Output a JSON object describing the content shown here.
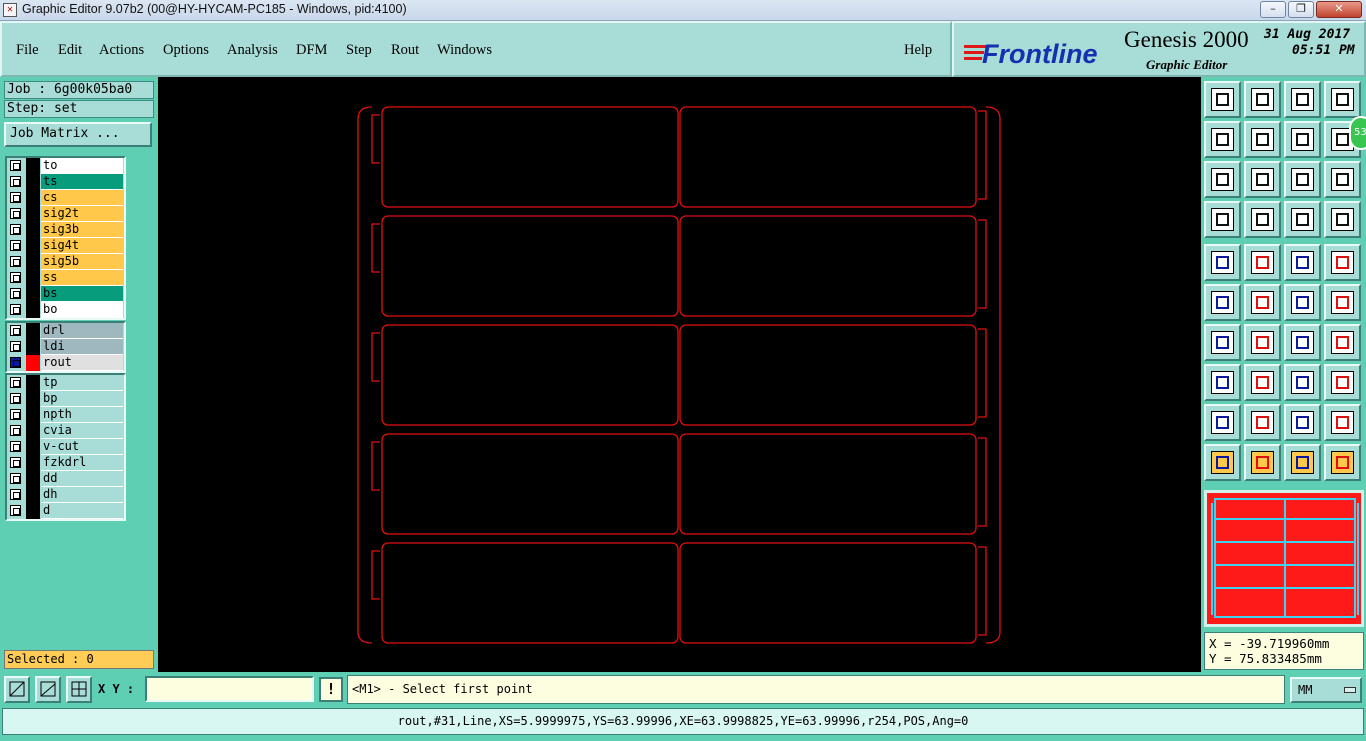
{
  "window": {
    "title": "Graphic Editor 9.07b2 (00@HY-HYCAM-PC185 - Windows, pid:4100)",
    "app_icon": "x-window-icon"
  },
  "menu": {
    "items": [
      "File",
      "Edit",
      "Actions",
      "Options",
      "Analysis",
      "DFM",
      "Step",
      "Rout",
      "Windows"
    ],
    "help": "Help"
  },
  "brand": {
    "logo": "Frontline",
    "product": "Genesis 2000",
    "subtitle": "Graphic Editor",
    "date": "31 Aug 2017",
    "time": "05:51 PM"
  },
  "job": {
    "job_label": "Job : 6g00k05ba0",
    "step_label": "Step: set",
    "matrix_button": "Job Matrix ..."
  },
  "layers": {
    "board": [
      {
        "name": "to",
        "color": "#ffffff"
      },
      {
        "name": "ts",
        "color": "#079c7c"
      },
      {
        "name": "cs",
        "color": "#ffc84a"
      },
      {
        "name": "sig2t",
        "color": "#ffc84a"
      },
      {
        "name": "sig3b",
        "color": "#ffc84a"
      },
      {
        "name": "sig4t",
        "color": "#ffc84a"
      },
      {
        "name": "sig5b",
        "color": "#ffc84a"
      },
      {
        "name": "ss",
        "color": "#ffc84a"
      },
      {
        "name": "bs",
        "color": "#079c7c"
      },
      {
        "name": "bo",
        "color": "#ffffff"
      }
    ],
    "drill": [
      {
        "name": "drl",
        "color": "#9fb8c0"
      },
      {
        "name": "ldi",
        "color": "#9fb8c0"
      },
      {
        "name": "rout",
        "color": "#e0e0e0",
        "active": true
      }
    ],
    "misc": [
      {
        "name": "tp",
        "color": "#a8dcd6"
      },
      {
        "name": "bp",
        "color": "#a8dcd6"
      },
      {
        "name": "npth",
        "color": "#a8dcd6"
      },
      {
        "name": "cvia",
        "color": "#a8dcd6"
      },
      {
        "name": "v-cut",
        "color": "#a8dcd6"
      },
      {
        "name": "fzkdrl",
        "color": "#a8dcd6"
      },
      {
        "name": "dd",
        "color": "#a8dcd6"
      },
      {
        "name": "dh",
        "color": "#a8dcd6"
      },
      {
        "name": "d",
        "color": "#a8dcd6"
      }
    ]
  },
  "selected": "Selected : 0",
  "badge": "53",
  "coords": {
    "x": "X = -39.719960mm",
    "y": "Y =  75.833485mm"
  },
  "command": {
    "xy_label": "X Y :",
    "xy_value": "",
    "excl": "!",
    "prompt": "<M1> - Select first point",
    "unit": "MM"
  },
  "status": "rout,#31,Line,XS=5.9999975,YS=63.99996,XE=63.9998825,YE=63.99996,r254,POS,Ang=0",
  "colors": {
    "panel": "#5ecfb3",
    "field": "#a8dcd6",
    "rout": "#e01010",
    "preview": "#ff1a1a",
    "preview_lines": "#40d0f0"
  },
  "tools": [
    "up-arrow-icon",
    "down-arrow-icon",
    "home-icon",
    "zoom-window-icon",
    "left-arrow-icon",
    "right-arrow-icon",
    "undo-icon",
    "redo-icon",
    "fit-icon",
    "center-icon",
    "scale-1-2-icon",
    "help-icon",
    "settings-icon",
    "snap-icon",
    "layer-link-icon",
    "layer-link2-icon",
    "pad-icon",
    "rect-icon",
    "ruler-icon",
    "circle-icon",
    "connect-icon",
    "cross-icon",
    "node-icon",
    "point-icon",
    "angle-icon",
    "line-icon",
    "arc-icon",
    "mirror-icon",
    "scale-icon",
    "split-icon",
    "measure-icon",
    "polygon-icon",
    "triangle-icon",
    "triangle2-icon",
    "triangle3-icon",
    "triangle4-icon",
    "select-icon",
    "select2-icon",
    "select3-icon",
    "select4-icon"
  ]
}
